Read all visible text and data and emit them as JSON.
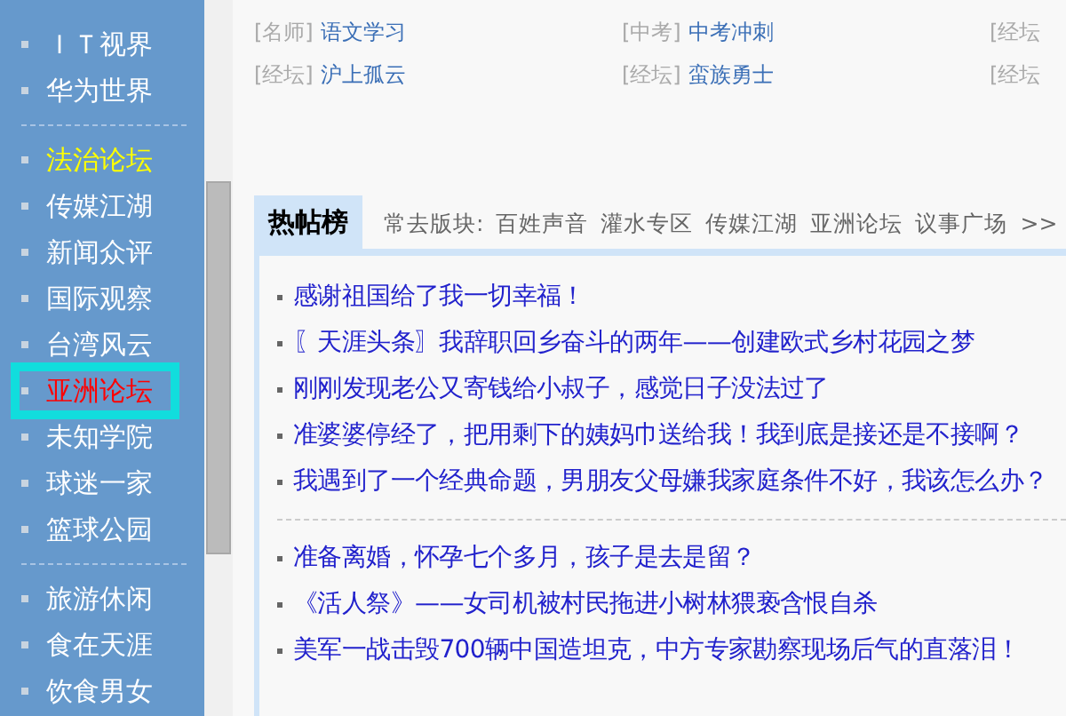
{
  "sidebar": {
    "groups": [
      {
        "items": [
          {
            "label": "ＩＴ视界",
            "selected": false,
            "highlighted": false
          },
          {
            "label": "华为世界",
            "selected": false,
            "highlighted": false
          }
        ]
      },
      {
        "items": [
          {
            "label": "法治论坛",
            "selected": true,
            "highlighted": false
          },
          {
            "label": "传媒江湖",
            "selected": false,
            "highlighted": false
          },
          {
            "label": "新闻众评",
            "selected": false,
            "highlighted": false
          },
          {
            "label": "国际观察",
            "selected": false,
            "highlighted": false
          },
          {
            "label": "台湾风云",
            "selected": false,
            "highlighted": false
          },
          {
            "label": "亚洲论坛",
            "selected": false,
            "highlighted": true
          },
          {
            "label": "未知学院",
            "selected": false,
            "highlighted": false
          },
          {
            "label": "球迷一家",
            "selected": false,
            "highlighted": false
          },
          {
            "label": "篮球公园",
            "selected": false,
            "highlighted": false
          }
        ]
      },
      {
        "items": [
          {
            "label": "旅游休闲",
            "selected": false,
            "highlighted": false
          },
          {
            "label": "食在天涯",
            "selected": false,
            "highlighted": false
          },
          {
            "label": "饮食男女",
            "selected": false,
            "highlighted": false
          }
        ]
      }
    ]
  },
  "recommend": [
    [
      {
        "tag": "[名师]",
        "title": "语文学习"
      },
      {
        "tag": "[中考]",
        "title": "中考冲刺"
      },
      {
        "tag": "[经坛"
      }
    ],
    [
      {
        "tag": "[经坛]",
        "title": "沪上孤云"
      },
      {
        "tag": "[经坛]",
        "title": "蛮族勇士"
      },
      {
        "tag": "[经坛"
      }
    ]
  ],
  "hot_posts": {
    "tab": "热帖榜",
    "frequent_label": "常去版块:",
    "frequent_boards": [
      "百姓声音",
      "灌水专区",
      "传媒江湖",
      "亚洲论坛",
      "议事广场"
    ],
    "more": ">>",
    "groups": [
      [
        "感谢祖国给了我一切幸福！",
        "〖天涯头条〗我辞职回乡奋斗的两年——创建欧式乡村花园之梦",
        "刚刚发现老公又寄钱给小叔子，感觉日子没法过了",
        "准婆婆停经了，把用剩下的姨妈巾送给我！我到底是接还是不接啊？",
        "我遇到了一个经典命题，男朋友父母嫌我家庭条件不好，我该怎么办？"
      ],
      [
        "准备离婚，怀孕七个多月，孩子是去是留？",
        "《活人祭》——女司机被村民拖进小树林猥亵含恨自杀",
        "美军一战击毁700辆中国造坦克，中方专家勘察现场后气的直落泪！"
      ]
    ]
  }
}
